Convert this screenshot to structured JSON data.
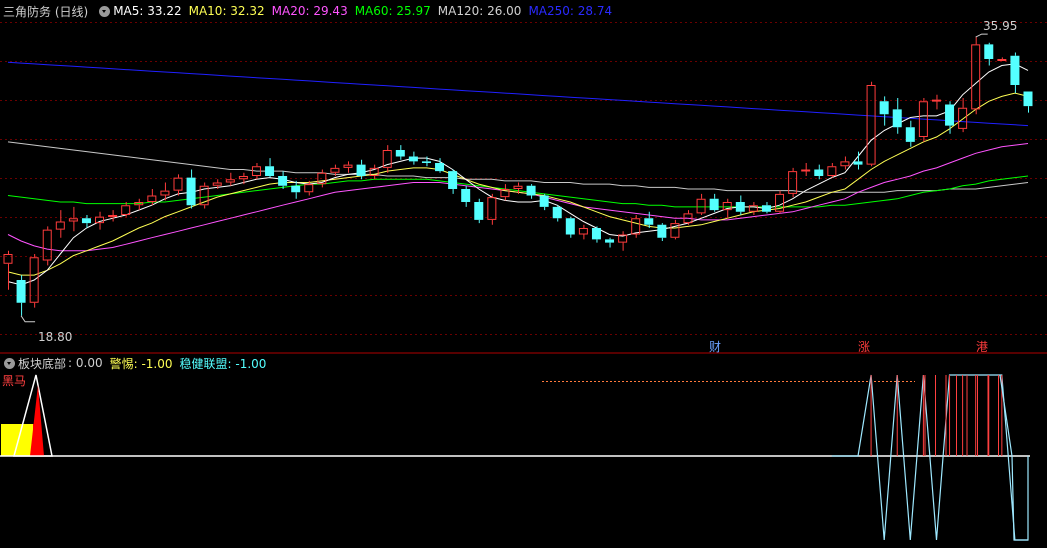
{
  "main_header": {
    "title": "三角防务 (日线)",
    "ma5": "MA5: 33.22",
    "ma10": "MA10: 32.32",
    "ma20": "MA20: 29.43",
    "ma60": "MA60: 25.97",
    "ma120": "MA120: 26.00",
    "ma250": "MA250: 28.74"
  },
  "price_high_label": "35.95",
  "price_low_label": "18.80",
  "event_markers": [
    "财",
    "涨",
    "港"
  ],
  "sub_header": {
    "title": "板块底部",
    "value": ": 0.00",
    "warn": "警惕: -1.00",
    "steady": "稳健联盟: -1.00"
  },
  "sub_label": "黑马",
  "colors": {
    "up": "#ff3c3c",
    "down": "#54ffff",
    "ma5": "#ffffff",
    "ma10": "#ffff54",
    "ma20": "#ff54ff",
    "ma60": "#00ff00",
    "ma120": "#c8c8c8",
    "ma250": "#2020ff",
    "separator": "#b00000"
  },
  "candles": [
    [
      22.0,
      22.8,
      20.4,
      22.6
    ],
    [
      21.0,
      21.3,
      18.8,
      19.6
    ],
    [
      19.6,
      22.6,
      19.3,
      22.4
    ],
    [
      22.2,
      24.3,
      21.9,
      24.1
    ],
    [
      24.1,
      25.3,
      23.6,
      24.6
    ],
    [
      24.6,
      25.5,
      24.0,
      24.8
    ],
    [
      24.8,
      25.0,
      24.2,
      24.5
    ],
    [
      24.5,
      25.2,
      24.1,
      24.9
    ],
    [
      24.9,
      25.3,
      24.6,
      25.0
    ],
    [
      25.0,
      25.8,
      24.9,
      25.6
    ],
    [
      25.6,
      26.0,
      25.3,
      25.8
    ],
    [
      25.8,
      26.6,
      25.6,
      26.2
    ],
    [
      26.2,
      27.0,
      25.9,
      26.5
    ],
    [
      26.5,
      27.5,
      26.2,
      27.3
    ],
    [
      27.3,
      27.8,
      25.4,
      25.6
    ],
    [
      25.6,
      27.0,
      25.4,
      26.8
    ],
    [
      26.8,
      27.2,
      26.6,
      27.0
    ],
    [
      27.0,
      27.6,
      26.8,
      27.2
    ],
    [
      27.2,
      27.6,
      26.9,
      27.4
    ],
    [
      27.4,
      28.2,
      27.2,
      28.0
    ],
    [
      28.0,
      28.5,
      27.3,
      27.4
    ],
    [
      27.4,
      27.7,
      26.6,
      26.8
    ],
    [
      26.8,
      27.1,
      26.0,
      26.4
    ],
    [
      26.4,
      27.1,
      26.2,
      26.9
    ],
    [
      26.9,
      27.8,
      26.7,
      27.6
    ],
    [
      27.6,
      28.1,
      27.4,
      27.9
    ],
    [
      27.9,
      28.3,
      27.6,
      28.1
    ],
    [
      28.1,
      28.4,
      27.2,
      27.4
    ],
    [
      27.4,
      28.1,
      27.2,
      27.9
    ],
    [
      27.9,
      29.3,
      27.6,
      29.0
    ],
    [
      29.0,
      29.3,
      28.4,
      28.6
    ],
    [
      28.6,
      28.9,
      28.1,
      28.3
    ],
    [
      28.3,
      28.6,
      28.0,
      28.2
    ],
    [
      28.2,
      28.5,
      27.6,
      27.7
    ],
    [
      27.7,
      27.8,
      26.3,
      26.6
    ],
    [
      26.6,
      26.8,
      25.5,
      25.8
    ],
    [
      25.8,
      26.0,
      24.5,
      24.7
    ],
    [
      24.7,
      26.3,
      24.4,
      26.1
    ],
    [
      26.1,
      26.9,
      25.9,
      26.6
    ],
    [
      26.6,
      27.0,
      26.3,
      26.8
    ],
    [
      26.8,
      26.9,
      26.0,
      26.2
    ],
    [
      26.2,
      26.3,
      25.3,
      25.5
    ],
    [
      25.5,
      25.6,
      24.6,
      24.8
    ],
    [
      24.8,
      24.9,
      23.6,
      23.8
    ],
    [
      23.8,
      24.4,
      23.5,
      24.2
    ],
    [
      24.2,
      24.3,
      23.3,
      23.5
    ],
    [
      23.5,
      23.6,
      23.0,
      23.3
    ],
    [
      23.3,
      24.0,
      22.8,
      23.8
    ],
    [
      23.8,
      25.0,
      23.6,
      24.8
    ],
    [
      24.8,
      25.2,
      24.2,
      24.4
    ],
    [
      24.4,
      24.5,
      23.4,
      23.6
    ],
    [
      23.6,
      24.7,
      23.5,
      24.5
    ],
    [
      24.5,
      25.3,
      24.4,
      25.1
    ],
    [
      25.1,
      26.3,
      25.0,
      26.0
    ],
    [
      26.0,
      26.3,
      25.2,
      25.3
    ],
    [
      25.3,
      26.0,
      24.8,
      25.8
    ],
    [
      25.8,
      26.2,
      25.0,
      25.2
    ],
    [
      25.2,
      25.8,
      25.0,
      25.6
    ],
    [
      25.6,
      25.8,
      25.1,
      25.2
    ],
    [
      25.2,
      26.5,
      25.1,
      26.3
    ],
    [
      26.3,
      27.9,
      26.1,
      27.7
    ],
    [
      27.7,
      28.2,
      27.4,
      27.8
    ],
    [
      27.8,
      28.1,
      27.2,
      27.4
    ],
    [
      27.4,
      28.2,
      27.3,
      28.0
    ],
    [
      28.0,
      28.6,
      27.8,
      28.3
    ],
    [
      28.3,
      28.9,
      27.8,
      28.1
    ],
    [
      28.1,
      33.2,
      28.0,
      33.0
    ],
    [
      32.0,
      32.3,
      30.5,
      31.2
    ],
    [
      31.5,
      32.2,
      30.0,
      30.4
    ],
    [
      30.4,
      30.8,
      29.2,
      29.5
    ],
    [
      29.8,
      32.2,
      29.5,
      32.0
    ],
    [
      32.0,
      32.4,
      31.5,
      32.1
    ],
    [
      31.8,
      32.0,
      30.0,
      30.5
    ],
    [
      30.3,
      32.2,
      30.1,
      31.6
    ],
    [
      31.5,
      35.95,
      31.2,
      35.5
    ],
    [
      35.5,
      35.6,
      34.2,
      34.6
    ],
    [
      34.6,
      34.7,
      34.5,
      34.6
    ],
    [
      34.8,
      35.0,
      32.5,
      33.0
    ],
    [
      32.6,
      32.6,
      31.3,
      31.7
    ]
  ],
  "ma5_values": [
    20.9,
    20.7,
    21.0,
    21.6,
    22.6,
    23.6,
    24.2,
    24.6,
    24.8,
    25.0,
    25.3,
    25.6,
    26.0,
    26.3,
    26.4,
    26.6,
    26.7,
    26.8,
    27.0,
    27.2,
    27.3,
    27.2,
    27.0,
    26.9,
    27.0,
    27.3,
    27.5,
    27.6,
    27.8,
    28.1,
    28.3,
    28.5,
    28.5,
    28.3,
    27.8,
    27.2,
    26.6,
    26.1,
    25.9,
    25.8,
    25.8,
    25.9,
    25.6,
    25.1,
    24.6,
    24.2,
    23.8,
    23.7,
    23.9,
    24.0,
    24.1,
    24.3,
    24.5,
    24.8,
    25.1,
    25.4,
    25.5,
    25.5,
    25.4,
    25.6,
    26.0,
    26.5,
    26.9,
    27.3,
    27.6,
    28.6,
    29.6,
    30.2,
    30.6,
    31.0,
    31.1,
    31.1,
    31.4,
    32.4,
    33.1,
    33.8,
    34.2,
    34.3,
    33.9
  ],
  "ma10_values": [
    21.5,
    21.3,
    21.3,
    21.6,
    22.0,
    22.5,
    22.8,
    23.1,
    23.4,
    23.8,
    24.2,
    24.5,
    24.9,
    25.2,
    25.5,
    25.8,
    26.1,
    26.3,
    26.5,
    26.7,
    26.9,
    27.0,
    27.0,
    27.0,
    27.1,
    27.2,
    27.3,
    27.4,
    27.5,
    27.7,
    27.8,
    27.9,
    27.9,
    27.8,
    27.5,
    27.2,
    26.9,
    26.7,
    26.5,
    26.4,
    26.3,
    26.2,
    26.0,
    25.8,
    25.5,
    25.2,
    24.9,
    24.7,
    24.5,
    24.3,
    24.2,
    24.2,
    24.3,
    24.4,
    24.6,
    24.8,
    25.0,
    25.2,
    25.3,
    25.4,
    25.6,
    25.8,
    26.1,
    26.4,
    26.6,
    27.2,
    27.8,
    28.3,
    28.7,
    29.1,
    29.5,
    29.8,
    30.3,
    30.9,
    31.5,
    32.0,
    32.3,
    32.5,
    32.3
  ],
  "ma20_values": [
    23.8,
    23.4,
    23.1,
    22.9,
    22.8,
    22.8,
    22.8,
    22.9,
    23.0,
    23.2,
    23.4,
    23.6,
    23.8,
    24.0,
    24.2,
    24.4,
    24.6,
    24.8,
    25.0,
    25.2,
    25.4,
    25.6,
    25.8,
    26.0,
    26.2,
    26.4,
    26.5,
    26.6,
    26.7,
    26.8,
    26.9,
    27.0,
    27.0,
    27.0,
    26.9,
    26.8,
    26.7,
    26.6,
    26.5,
    26.4,
    26.3,
    26.1,
    25.9,
    25.7,
    25.5,
    25.4,
    25.3,
    25.2,
    25.1,
    25.0,
    24.9,
    24.8,
    24.8,
    24.7,
    24.7,
    24.7,
    24.8,
    24.9,
    25.0,
    25.1,
    25.2,
    25.4,
    25.6,
    25.8,
    26.0,
    26.4,
    26.7,
    27.0,
    27.2,
    27.4,
    27.7,
    27.9,
    28.2,
    28.5,
    28.8,
    29.0,
    29.2,
    29.3,
    29.4
  ],
  "ma60_values": [
    26.2,
    26.1,
    26.0,
    25.9,
    25.8,
    25.8,
    25.7,
    25.7,
    25.7,
    25.7,
    25.7,
    25.8,
    25.8,
    25.9,
    26.0,
    26.1,
    26.2,
    26.3,
    26.4,
    26.5,
    26.6,
    26.7,
    26.8,
    26.9,
    26.9,
    27.0,
    27.1,
    27.1,
    27.2,
    27.2,
    27.2,
    27.2,
    27.2,
    27.1,
    27.0,
    26.9,
    26.8,
    26.7,
    26.6,
    26.5,
    26.4,
    26.3,
    26.2,
    26.1,
    26.0,
    25.9,
    25.8,
    25.7,
    25.7,
    25.6,
    25.6,
    25.5,
    25.5,
    25.5,
    25.5,
    25.5,
    25.5,
    25.5,
    25.5,
    25.5,
    25.5,
    25.5,
    25.5,
    25.6,
    25.6,
    25.7,
    25.8,
    25.9,
    26.0,
    26.2,
    26.4,
    26.5,
    26.6,
    26.8,
    26.9,
    27.1,
    27.2,
    27.3,
    27.4
  ],
  "ma120_values": [
    29.5,
    29.4,
    29.3,
    29.2,
    29.1,
    29.0,
    28.9,
    28.8,
    28.7,
    28.6,
    28.5,
    28.4,
    28.3,
    28.2,
    28.1,
    28.0,
    27.9,
    27.8,
    27.8,
    27.7,
    27.7,
    27.7,
    27.6,
    27.6,
    27.6,
    27.5,
    27.5,
    27.5,
    27.5,
    27.4,
    27.4,
    27.4,
    27.3,
    27.3,
    27.3,
    27.2,
    27.2,
    27.2,
    27.1,
    27.1,
    27.1,
    27.0,
    27.0,
    27.0,
    26.9,
    26.9,
    26.9,
    26.8,
    26.8,
    26.7,
    26.7,
    26.7,
    26.6,
    26.6,
    26.6,
    26.5,
    26.5,
    26.5,
    26.5,
    26.5,
    26.5,
    26.4,
    26.4,
    26.4,
    26.4,
    26.4,
    26.4,
    26.4,
    26.5,
    26.5,
    26.5,
    26.5,
    26.6,
    26.6,
    26.6,
    26.7,
    26.8,
    26.9,
    27.0
  ],
  "ma250_values": [
    34.4,
    34.35,
    34.3,
    34.25,
    34.2,
    34.15,
    34.1,
    34.05,
    34.0,
    33.95,
    33.9,
    33.85,
    33.8,
    33.75,
    33.7,
    33.65,
    33.6,
    33.55,
    33.5,
    33.45,
    33.4,
    33.35,
    33.3,
    33.25,
    33.2,
    33.15,
    33.1,
    33.05,
    33.0,
    32.95,
    32.9,
    32.85,
    32.8,
    32.75,
    32.7,
    32.65,
    32.6,
    32.55,
    32.5,
    32.45,
    32.4,
    32.35,
    32.3,
    32.25,
    32.2,
    32.15,
    32.1,
    32.05,
    32.0,
    31.95,
    31.9,
    31.85,
    31.8,
    31.75,
    31.7,
    31.65,
    31.6,
    31.55,
    31.5,
    31.45,
    31.4,
    31.35,
    31.3,
    31.25,
    31.2,
    31.15,
    31.1,
    31.05,
    31.0,
    30.95,
    30.9,
    30.85,
    30.8,
    30.75,
    30.7,
    30.65,
    30.6,
    30.55,
    30.5
  ],
  "signal_bottom": [
    0,
    0,
    1,
    0,
    0,
    0,
    0,
    0,
    0,
    0,
    0,
    0,
    0,
    0,
    0,
    0,
    0,
    0,
    0,
    0,
    0,
    0,
    0,
    0,
    0,
    0,
    0,
    0,
    0,
    0,
    0,
    0,
    0,
    0,
    0,
    0,
    0,
    0,
    0,
    0,
    0,
    0,
    0,
    0,
    0,
    0,
    0,
    0,
    0,
    0,
    0,
    0,
    0,
    0,
    0,
    0,
    0,
    0,
    0,
    0,
    0,
    0,
    0,
    0,
    0,
    0,
    0,
    0,
    0,
    0,
    0,
    0,
    0,
    0,
    0,
    0,
    0,
    0,
    0
  ],
  "signal_warn": [
    0,
    0,
    0,
    0,
    0,
    0,
    0,
    0,
    0,
    0,
    0,
    0,
    0,
    0,
    0,
    0,
    0,
    0,
    0,
    0,
    0,
    0,
    0,
    0,
    0,
    0,
    0,
    0,
    0,
    0,
    0,
    0,
    0,
    0,
    0,
    0,
    0,
    0,
    0,
    0,
    0,
    0,
    0,
    0,
    0,
    0,
    0,
    0,
    0,
    0,
    0,
    0,
    0,
    0,
    0,
    0,
    0,
    0,
    0,
    0,
    0,
    0,
    0,
    0,
    0,
    0,
    1,
    -1,
    1,
    -1,
    1,
    -1,
    1,
    1,
    1,
    1,
    1,
    -1,
    -1
  ],
  "sub_flat_value": 0.0,
  "sub_warn_line_value": 0.9
}
